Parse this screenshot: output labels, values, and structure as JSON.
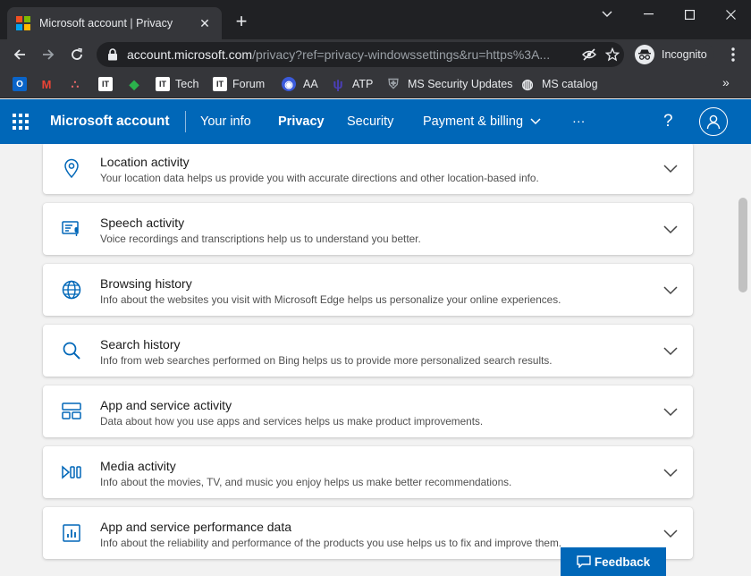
{
  "browser": {
    "tab_title": "Microsoft account | Privacy",
    "tab_close": "✕",
    "new_tab": "+",
    "url_host": "account.microsoft.com",
    "url_path": "/privacy?ref=privacy-windowssettings&ru=https%3A...",
    "incognito_label": "Incognito",
    "bookmarks_more": "»",
    "bookmarks": [
      {
        "label": "",
        "icon": "outlook-icon",
        "icon_text": "O",
        "color": "#0a64c8"
      },
      {
        "label": "",
        "icon": "gmail-icon",
        "icon_text": "M",
        "color": "#ea4335"
      },
      {
        "label": "",
        "icon": "asana-icon",
        "icon_text": "∴",
        "color": "#f06a6a"
      },
      {
        "label": "",
        "icon": "it-icon",
        "icon_text": "IT",
        "color": "#ffffff"
      },
      {
        "label": "",
        "icon": "feedly-icon",
        "icon_text": "◆",
        "color": "#2bb24c"
      },
      {
        "label": "Tech",
        "icon": "it-icon",
        "icon_text": "IT",
        "color": "#ffffff"
      },
      {
        "label": "Forum",
        "icon": "it-icon",
        "icon_text": "IT",
        "color": "#ffffff"
      },
      {
        "label": "AA",
        "icon": "eye-icon",
        "icon_text": "◉",
        "color": "#3b5bdb"
      },
      {
        "label": "ATP",
        "icon": "atp-icon",
        "icon_text": "ψ",
        "color": "#4b3fb6"
      },
      {
        "label": "MS Security Updates",
        "icon": "shield-icon",
        "icon_text": "⛨",
        "color": "#9aa0a6"
      },
      {
        "label": "MS catalog",
        "icon": "globe-icon",
        "icon_text": "◍",
        "color": "#e8eaed"
      }
    ]
  },
  "header": {
    "brand": "Microsoft account",
    "nav": {
      "your_info": "Your info",
      "privacy": "Privacy",
      "security": "Security",
      "payment": "Payment & billing",
      "more": "···"
    },
    "help": "?"
  },
  "cards": [
    {
      "title": "Location activity",
      "desc": "Your location data helps us provide you with accurate directions and other location-based info.",
      "icon": "location-pin-icon"
    },
    {
      "title": "Speech activity",
      "desc": "Voice recordings and transcriptions help us to understand you better.",
      "icon": "speech-icon"
    },
    {
      "title": "Browsing history",
      "desc": "Info about the websites you visit with Microsoft Edge helps us personalize your online experiences.",
      "icon": "globe-icon"
    },
    {
      "title": "Search history",
      "desc": "Info from web searches performed on Bing helps us to provide more personalized search results.",
      "icon": "search-icon"
    },
    {
      "title": "App and service activity",
      "desc": "Data about how you use apps and services helps us make product improvements.",
      "icon": "app-grid-icon"
    },
    {
      "title": "Media activity",
      "desc": "Info about the movies, TV, and music you enjoy helps us make better recommendations.",
      "icon": "media-icon"
    },
    {
      "title": "App and service performance data",
      "desc": "Info about the reliability and performance of the products you use helps us to fix and improve them.",
      "icon": "chart-icon"
    }
  ],
  "feedback": {
    "label": "Feedback"
  },
  "colors": {
    "accent": "#0067b8",
    "chrome_dark": "#202124",
    "chrome_toolbar": "#35363a"
  }
}
